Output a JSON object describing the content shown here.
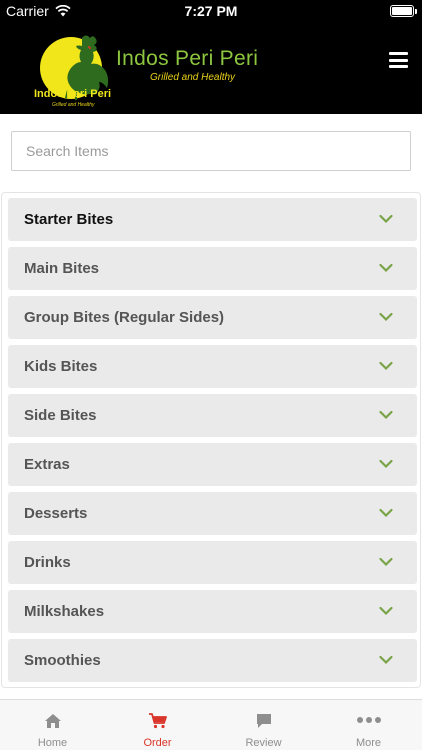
{
  "status_bar": {
    "carrier": "Carrier",
    "time": "7:27 PM"
  },
  "header": {
    "logo_title": "Indos Peri Peri",
    "logo_subtitle": "Grilled and Healthy",
    "logo_small_title": "Indos Peri Peri",
    "logo_small_subtitle": "Grilled and Healthy"
  },
  "search": {
    "placeholder": "Search Items",
    "value": ""
  },
  "categories": [
    {
      "label": "Starter Bites"
    },
    {
      "label": "Main Bites"
    },
    {
      "label": "Group Bites (Regular Sides)"
    },
    {
      "label": "Kids Bites"
    },
    {
      "label": "Side Bites"
    },
    {
      "label": "Extras"
    },
    {
      "label": "Desserts"
    },
    {
      "label": "Drinks"
    },
    {
      "label": "Milkshakes"
    },
    {
      "label": "Smoothies"
    }
  ],
  "tabs": [
    {
      "label": "Home",
      "icon": "home-icon"
    },
    {
      "label": "Order",
      "icon": "cart-icon"
    },
    {
      "label": "Review",
      "icon": "chat-icon"
    },
    {
      "label": "More",
      "icon": "more-icon"
    }
  ],
  "colors": {
    "chevron": "#78a347",
    "active_tab": "#d9352a",
    "inactive_tab": "#8e8e8e",
    "header_bg": "#000000"
  }
}
